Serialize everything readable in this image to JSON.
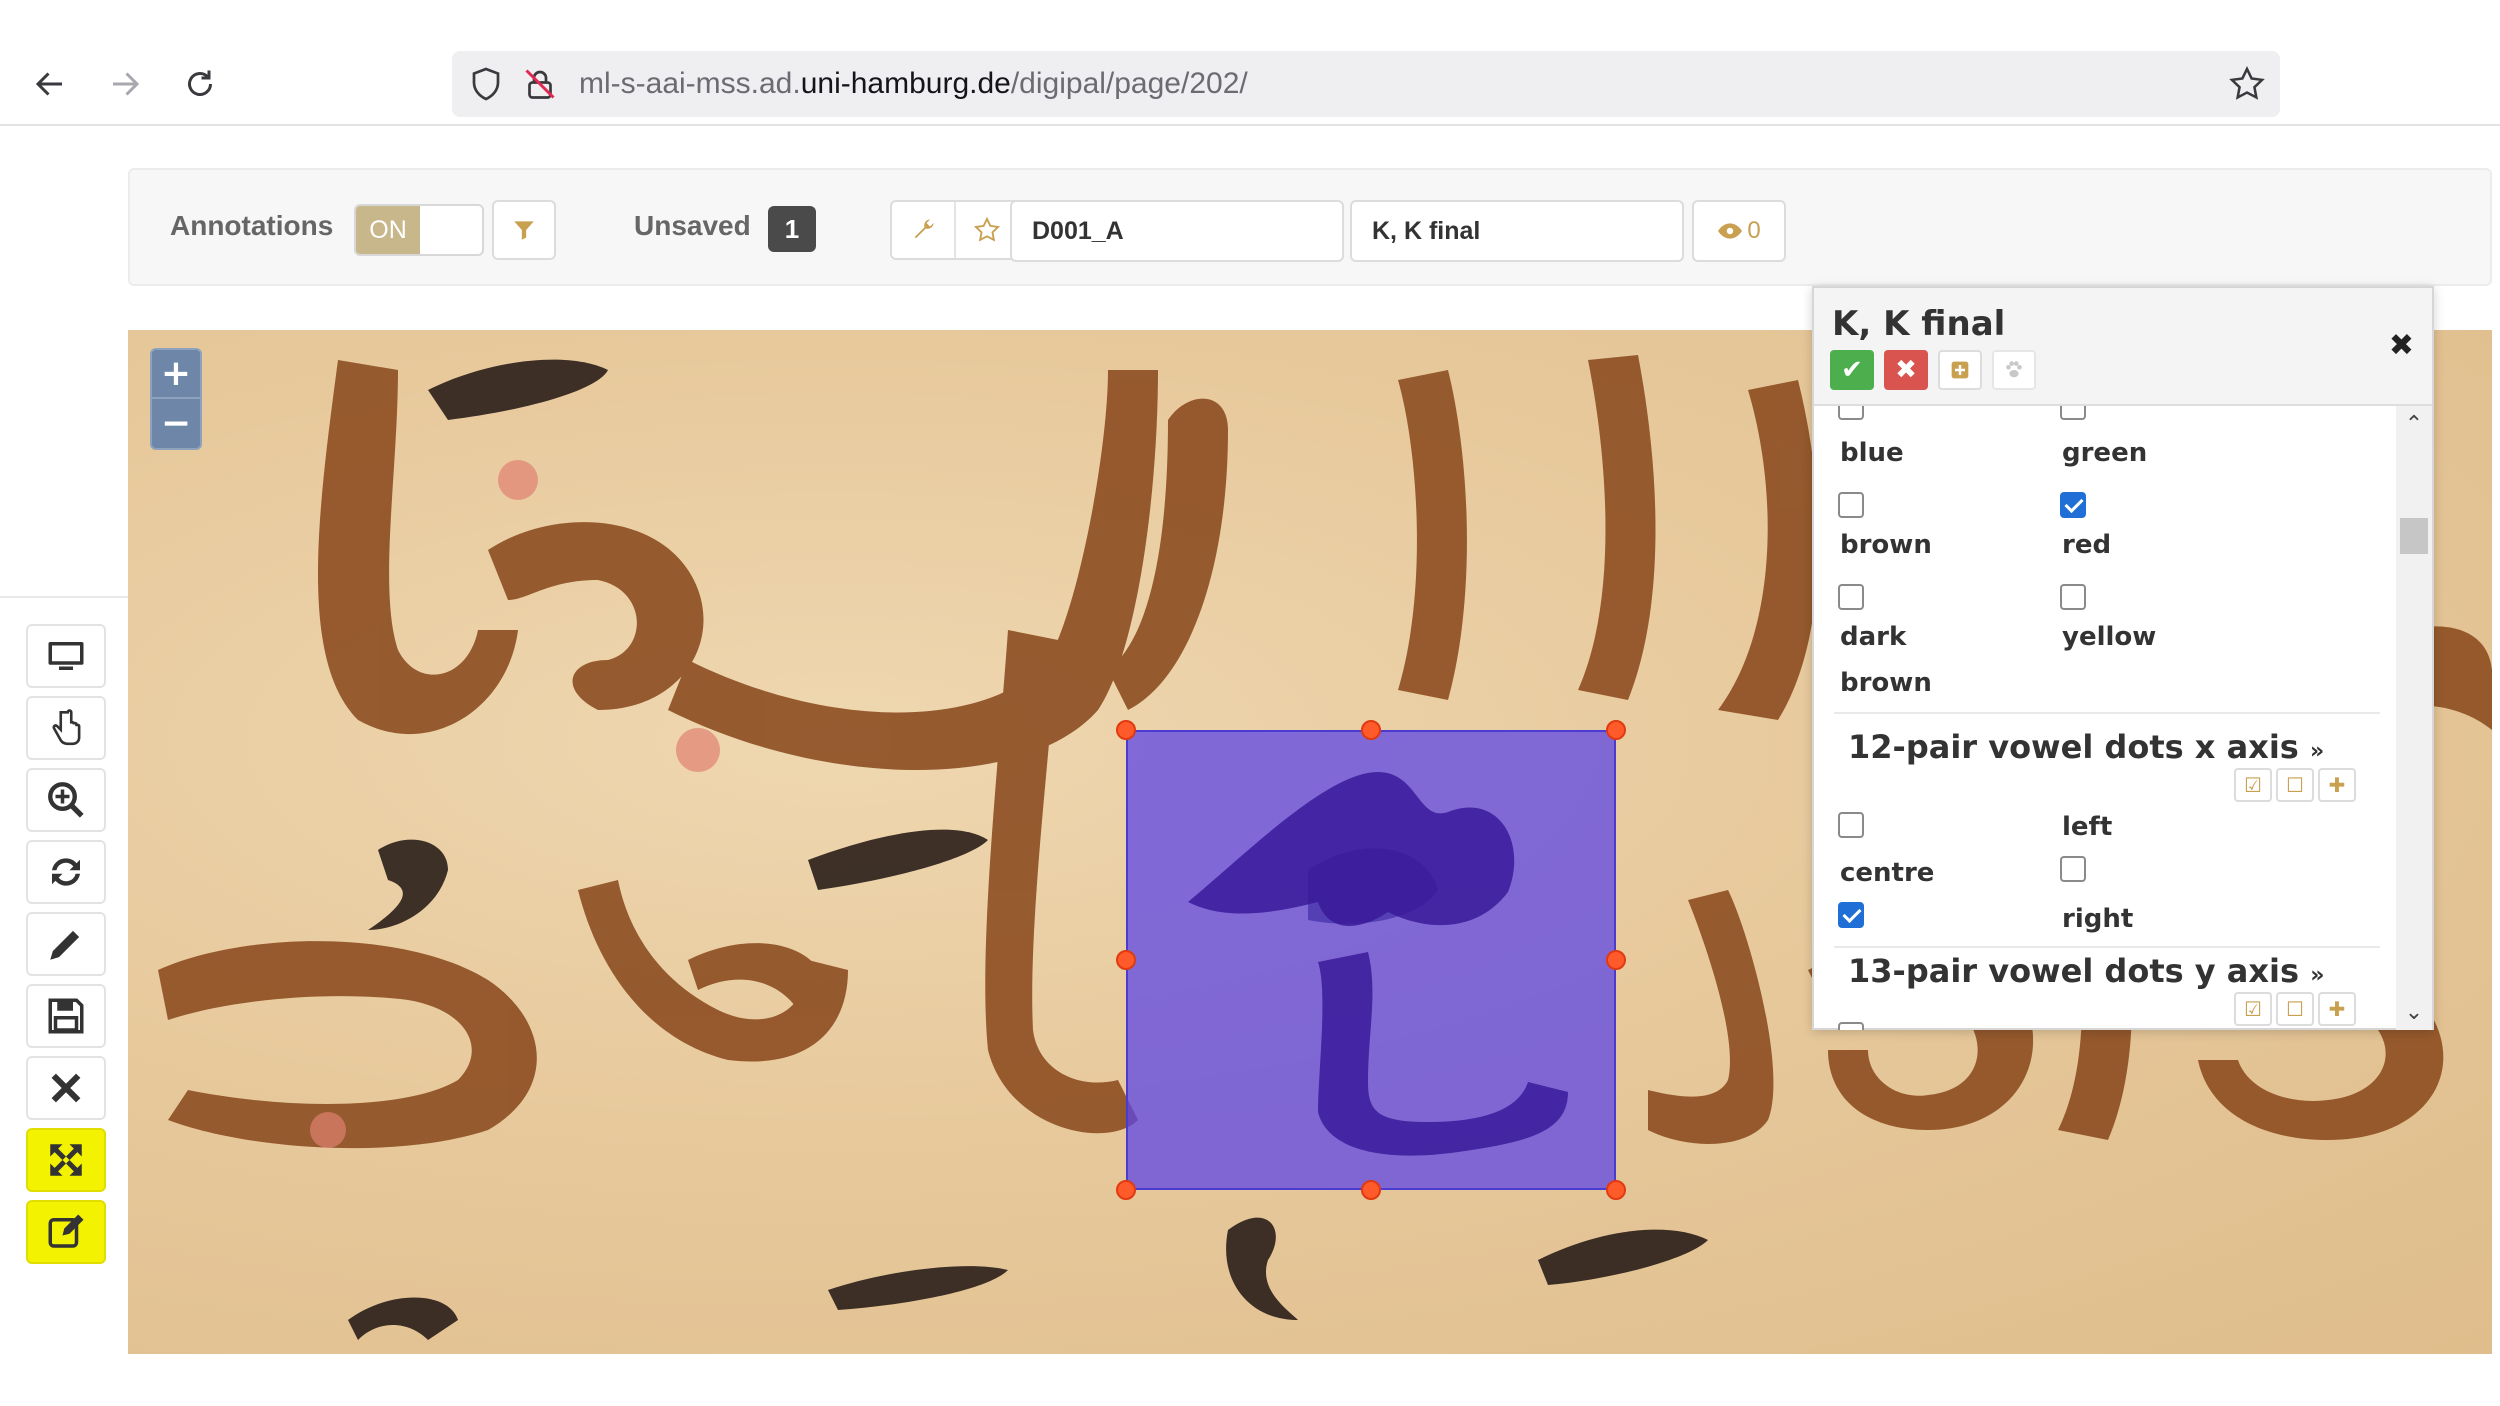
{
  "browser": {
    "url_prefix": "ml-s-aai-mss.ad.",
    "url_host": "uni-hamburg.de",
    "url_path": "/digipal/page/202/"
  },
  "toolbar": {
    "annotations_label": "Annotations",
    "annotations_toggle": "ON",
    "unsaved_label": "Unsaved",
    "unsaved_count": "1",
    "field_allograph": "D001_A",
    "field_character": "K, K final",
    "eye_count": "0"
  },
  "popup": {
    "title": "K, K final",
    "rows": [
      {
        "label": "blue"
      },
      {
        "label": "green"
      },
      {
        "label": "brown"
      },
      {
        "label": "red"
      },
      {
        "label": "dark"
      },
      {
        "label": "yellow"
      },
      {
        "label": "brown"
      }
    ],
    "section_x": {
      "title": "12-pair vowel dots x axis",
      "opt_left": "left",
      "opt_centre": "centre",
      "opt_right": "right"
    },
    "section_y": {
      "title": "13-pair vowel dots y axis"
    },
    "checked": {
      "brown": false,
      "red": true,
      "dark_brown": false,
      "yellow": false,
      "left": false,
      "right": false,
      "centre_row3": true
    }
  },
  "colors": {
    "accent_gold": "#c8a050",
    "selection": "#5c46e6",
    "handle": "#ff5a2a",
    "highlight_yellow": "#f3f200",
    "check_blue": "#1f6fd6",
    "save_green": "#4cae4c",
    "cancel_red": "#d9534f"
  },
  "icons": {
    "back": "arrow-left-icon",
    "forward": "arrow-right-icon",
    "reload": "reload-icon",
    "shield": "shield-icon",
    "lock": "lock-icon",
    "star": "bookmark-star-icon",
    "filter": "filter-icon",
    "wrench": "wrench-icon",
    "eye": "eye-icon"
  }
}
